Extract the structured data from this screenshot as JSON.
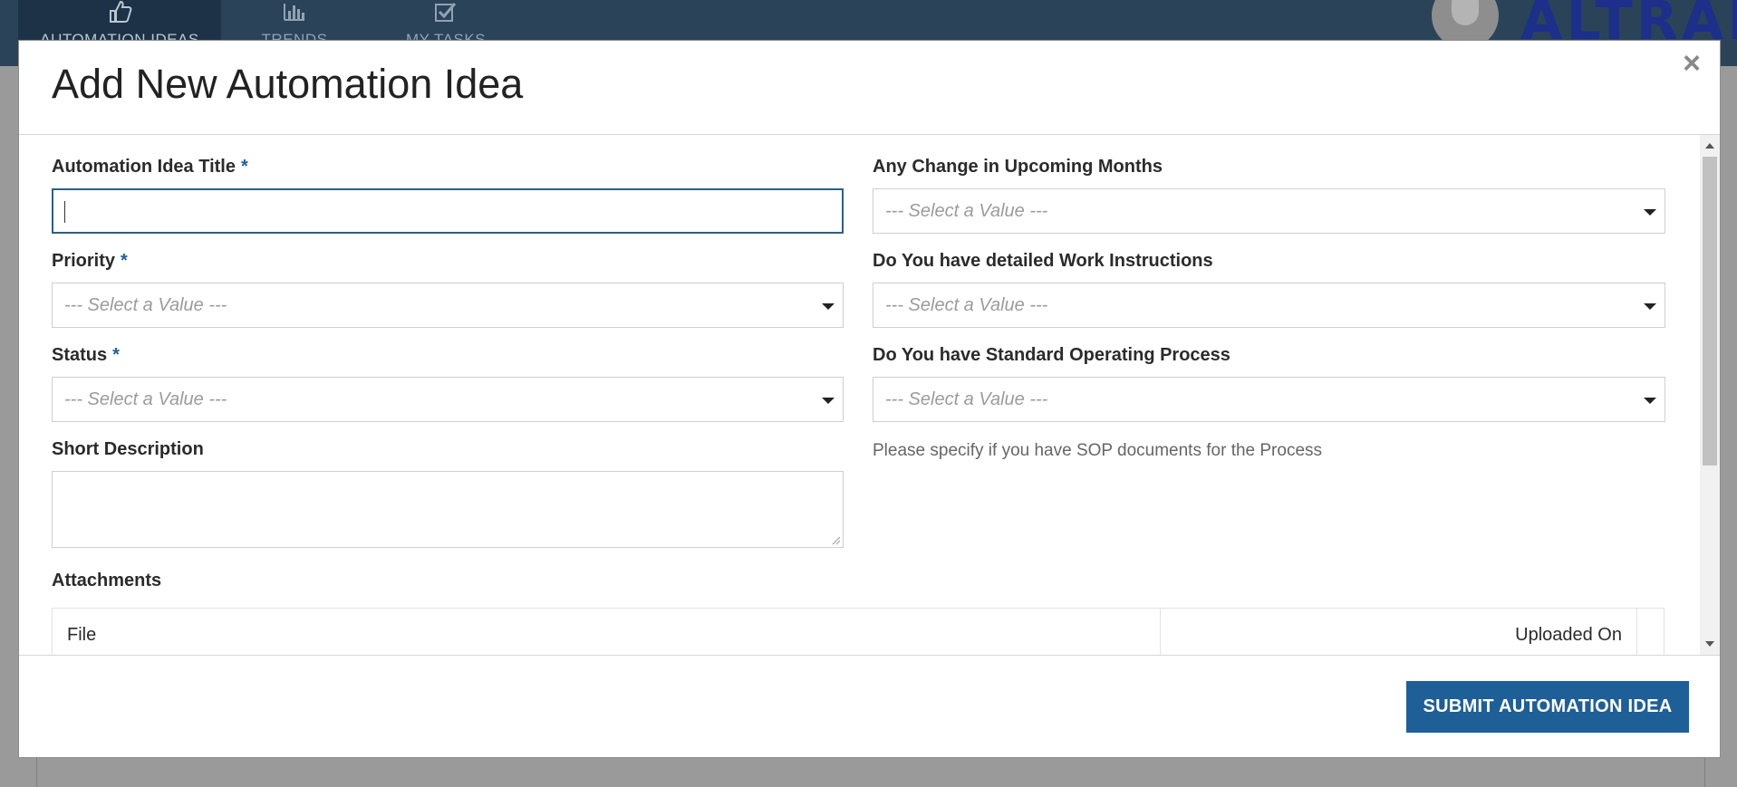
{
  "nav": {
    "tabs": [
      {
        "label": "AUTOMATION IDEAS",
        "icon": "thumbs-up-icon"
      },
      {
        "label": "TRENDS",
        "icon": "bar-chart-icon"
      },
      {
        "label": "MY TASKS",
        "icon": "checkbox-icon"
      }
    ],
    "brand": "ALTRAN"
  },
  "modal": {
    "title": "Add New Automation Idea",
    "close_label": "×",
    "left_column": {
      "title_label": "Automation Idea Title",
      "title_value": "",
      "priority_label": "Priority",
      "priority_value": "--- Select a Value ---",
      "status_label": "Status",
      "status_value": "--- Select a Value ---",
      "short_description_label": "Short Description",
      "required_mark": "*"
    },
    "right_column": {
      "change_label": "Any Change in Upcoming Months",
      "change_value": "--- Select a Value ---",
      "work_instructions_label": "Do You have detailed Work Instructions",
      "work_instructions_value": "--- Select a Value ---",
      "sop_label": "Do You have Standard Operating Process",
      "sop_value": "--- Select a Value ---",
      "sop_help": "Please specify if you have SOP documents for the Process"
    },
    "attachments": {
      "label": "Attachments",
      "columns": [
        "File",
        "Uploaded On"
      ]
    },
    "submit_label": "SUBMIT AUTOMATION IDEA"
  },
  "colors": {
    "header_bg": "#2b4358",
    "primary_button": "#1f5f98",
    "required_mark": "#1f5fa0"
  }
}
